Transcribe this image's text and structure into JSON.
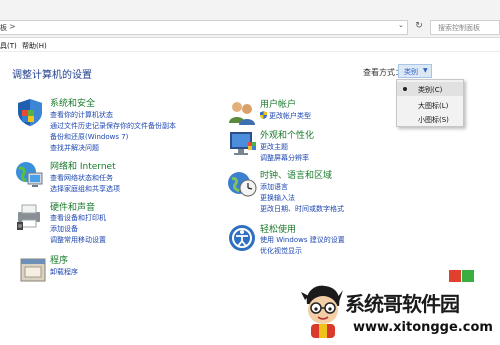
{
  "address_bar": {
    "path_fragment": "板",
    "chevron": ">",
    "search_placeholder": "搜索控制面板"
  },
  "menu": {
    "items": [
      "具(T)",
      "帮助(H)"
    ]
  },
  "page": {
    "title": "调整计算机的设置",
    "view_by_label": "查看方式：",
    "view_by_value": "类别"
  },
  "view_menu": {
    "options": [
      "类别(C)",
      "大图标(L)",
      "小图标(S)"
    ],
    "selected": 0
  },
  "categories_left": [
    {
      "title": "系统和安全",
      "icon": "shield-flag-icon",
      "links": [
        "查看你的计算机状态",
        "通过文件历史记录保存你的文件备份副本",
        "备份和还原(Windows 7)",
        "查找并解决问题"
      ]
    },
    {
      "title": "网络和 Internet",
      "icon": "network-globe-icon",
      "links": [
        "查看网络状态和任务",
        "选择家庭组和共享选项"
      ]
    },
    {
      "title": "硬件和声音",
      "icon": "printer-speaker-icon",
      "links": [
        "查看设备和打印机",
        "添加设备",
        "调整常用移动设置"
      ]
    },
    {
      "title": "程序",
      "icon": "programs-icon",
      "links": [
        "卸载程序"
      ]
    }
  ],
  "categories_right": [
    {
      "title": "用户帐户",
      "icon": "users-icon",
      "links": [
        "更改帐户类型"
      ],
      "first_link_has_shield": true
    },
    {
      "title": "外观和个性化",
      "icon": "monitor-palette-icon",
      "links": [
        "更改主题",
        "调整屏幕分辨率"
      ]
    },
    {
      "title": "时钟、语言和区域",
      "icon": "clock-globe-icon",
      "links": [
        "添加语言",
        "更换输入法",
        "更改日期、时间或数字格式"
      ]
    },
    {
      "title": "轻松使用",
      "icon": "ease-of-access-icon",
      "links": [
        "使用 Windows 建议的设置",
        "优化视觉显示"
      ]
    }
  ],
  "watermark": {
    "title": "系统哥软件园",
    "url": "www.xitongge.com"
  },
  "colors": {
    "category_title": "#1a7a2c",
    "link": "#1c46b0",
    "heading": "#1e3e8e"
  }
}
